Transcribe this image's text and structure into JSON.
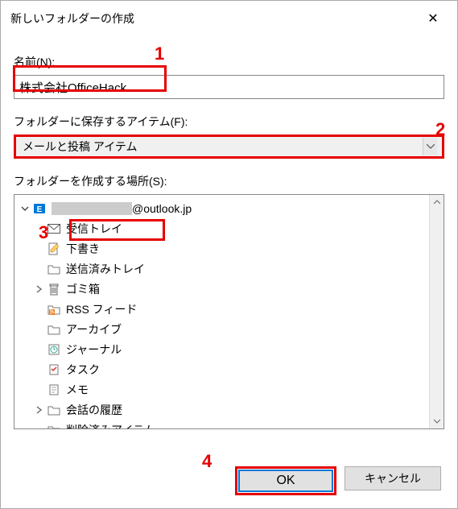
{
  "dialog": {
    "title": "新しいフォルダーの作成",
    "close": "✕"
  },
  "nameField": {
    "label": "名前(N):",
    "value": "株式会社OfficeHack"
  },
  "typeField": {
    "label": "フォルダーに保存するアイテム(F):",
    "value": "メールと投稿 アイテム"
  },
  "locationField": {
    "label": "フォルダーを作成する場所(S):",
    "account": "@outlook.jp",
    "items": [
      {
        "label": "受信トレイ",
        "icon": "mail"
      },
      {
        "label": "下書き",
        "icon": "draft"
      },
      {
        "label": "送信済みトレイ",
        "icon": "folder"
      },
      {
        "label": "ゴミ箱",
        "icon": "trash",
        "expander": "›"
      },
      {
        "label": "RSS フィード",
        "icon": "rss"
      },
      {
        "label": "アーカイブ",
        "icon": "folder"
      },
      {
        "label": "ジャーナル",
        "icon": "journal"
      },
      {
        "label": "タスク",
        "icon": "task"
      },
      {
        "label": "メモ",
        "icon": "note"
      },
      {
        "label": "会話の履歴",
        "icon": "folder",
        "expander": "›"
      },
      {
        "label": "削除済みアイテム",
        "icon": "folder"
      }
    ]
  },
  "buttons": {
    "ok": "OK",
    "cancel": "キャンセル"
  },
  "annotations": {
    "a1": "1",
    "a2": "2",
    "a3": "3",
    "a4": "4"
  }
}
